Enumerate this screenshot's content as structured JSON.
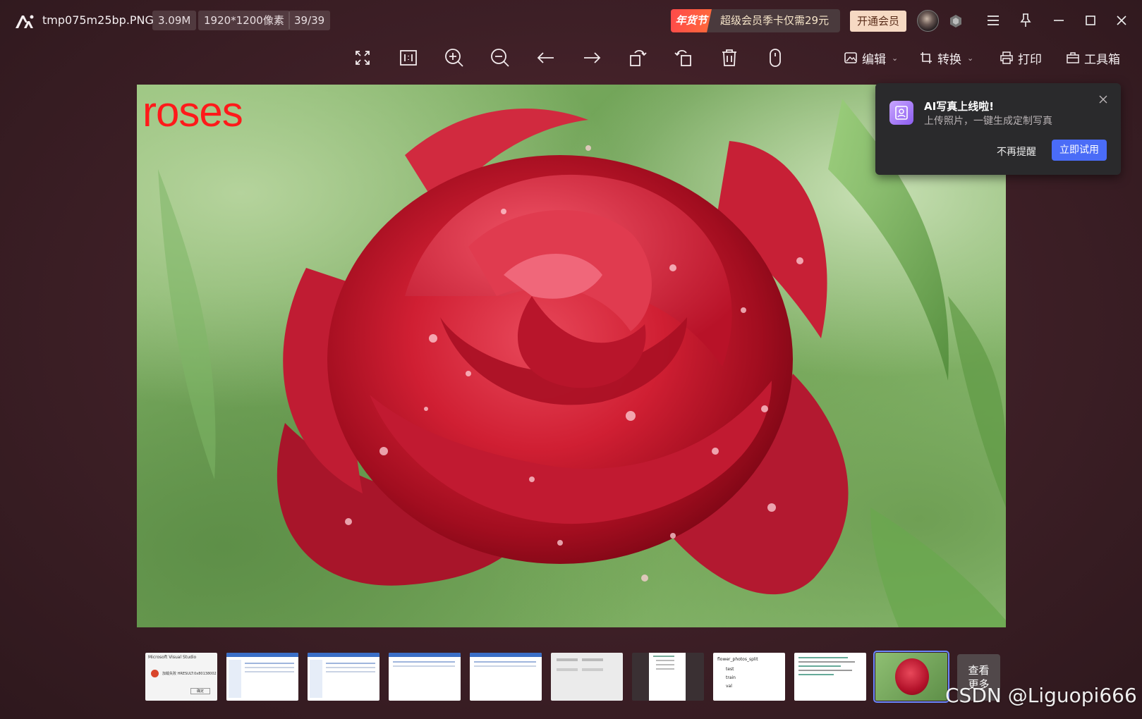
{
  "titlebar": {
    "filename": "tmp075m25bp.PNG",
    "file_size": "3.09M",
    "dimensions": "1920*1200像素",
    "position": "39/39",
    "promo_tag": "年货节",
    "promo_text": "超级会员季卡仅需29元",
    "vip_button": "开通会员"
  },
  "toolbar": {
    "icons": [
      "fullscreen-icon",
      "actual-size-icon",
      "zoom-in-icon",
      "zoom-out-icon",
      "previous-icon",
      "next-icon",
      "rotate-left-icon",
      "rotate-right-icon",
      "delete-icon",
      "mouse-icon"
    ],
    "edit_label": "编辑",
    "convert_label": "转换",
    "print_label": "打印",
    "toolbox_label": "工具箱"
  },
  "image": {
    "caption": "roses"
  },
  "popup": {
    "title": "AI写真上线啦!",
    "description": "上传照片，一键生成定制写真",
    "dismiss_label": "不再提醒",
    "try_label": "立即试用"
  },
  "thumbnails": {
    "more_label_line1": "查看",
    "more_label_line2": "更多",
    "items": [
      {
        "type": "dialog",
        "label": "Microsoft Visual Studio",
        "text": "加载失败 HRESULT:0x80138002",
        "button": "确定"
      },
      {
        "type": "app"
      },
      {
        "type": "app"
      },
      {
        "type": "app"
      },
      {
        "type": "app"
      },
      {
        "type": "form"
      },
      {
        "type": "tree"
      },
      {
        "type": "folder",
        "lines": [
          "flower_photos_split",
          "test",
          "train",
          "val"
        ]
      },
      {
        "type": "code"
      },
      {
        "type": "rose"
      }
    ]
  },
  "watermark": "CSDN @Liguopi666",
  "colors": {
    "accent": "#4a6cf7",
    "promo_red": "#ff4a4a",
    "vip_bg": "#f6d9c3",
    "caption_red": "#ff1a1a"
  }
}
